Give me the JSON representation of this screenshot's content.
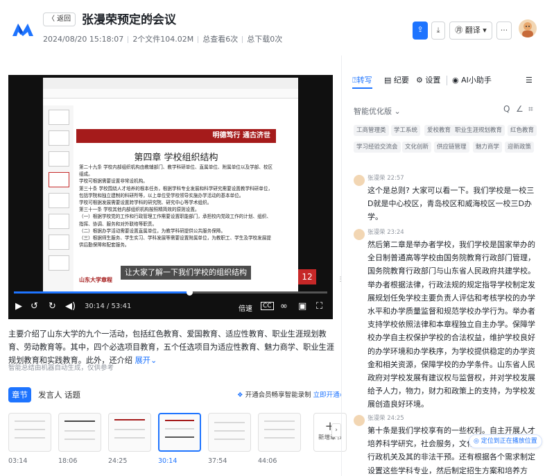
{
  "header": {
    "back_label": "〈 返回",
    "title": "张漫荣预定的会议",
    "edit_icon": "pencil-icon",
    "date": "2024/08/20 15:18:07",
    "files": "2个文件104.02M",
    "views": "总查看6次",
    "downloads": "总下载0次",
    "translate_label": "翻译",
    "more_label": "···",
    "share_icon": "share-icon",
    "download_icon": "download-icon"
  },
  "video": {
    "slide_banner": "明德笃行 通古济世",
    "slide_heading": "第四章 学校组织结构",
    "slide_body": [
      "第二十九条 学校内部组织机构由教辅部门、教学科研单位、直属单位、附属单位以及学部、校区组成。",
      "学校可根据需要设置非常设机构。",
      "第三十条 学校围绕人才培养的根本任务，根据学科专业发展和科学研究需要设置教学科研单位，包括学院和独立建制的科研所等，以上单位受学校领导实施办学活动的基本单位。",
      "学校可根据发展需要设置跨学科的研究院、研究中心等学术组织。",
      "第三十一条 学校其他内部组织机构按照精简效的原则设置。",
      "（一）根据学校党的工作和行政管理工作需要设置职能部门，承担校内党政工作的计划、组织、指挥、协调、服务和对外联络等职责。",
      "（二）根据办学活动需要设置直属单位，为教学科研提供公共服务保障。",
      "（三）根据师生服务、学生实习、学科发展等需要设置附属单位，为教职工、学生及学校发展提供后勤保障和配套服务。"
    ],
    "subtitle": "让大家了解一下我们学校的组织结构",
    "footer_text": "山东大学章程",
    "page_number": "12",
    "progress": 0.56,
    "time": "30:14 / 53:41",
    "speed_label": "倍速",
    "cc_label": "CC"
  },
  "summary": {
    "text": "主要介绍了山东大学的九个一活动，包括红色教育、爱国教育、适应性教育、职业生涯规划教育、劳动教育等。其中，四个必选项目教育，五个任选项目为适应性教育、魅力商学、职业生涯规划教育和实践教育。此外，还介绍",
    "expand_label": "展开",
    "note": "智能总结由机器自动生成，仅供参考"
  },
  "section_tabs": [
    "章节",
    "发言人",
    "话题"
  ],
  "vip": {
    "text": "开通会员畅享智能录制",
    "link": "立即开通"
  },
  "frames": {
    "times": [
      "03:14",
      "18:06",
      "24:25",
      "30:14",
      "37:54",
      "44:06"
    ],
    "add_label": "新增章节"
  },
  "right_panel": {
    "tabs": [
      "转写",
      "纪要",
      "设置",
      "AI小助手"
    ],
    "sort_label": "智能优化版",
    "tags": [
      "工商管理类",
      "学工系统",
      "爱校教育",
      "职业生涯规划教育",
      "红色教育",
      "学习经验交流会",
      "文化创新",
      "供应链管理",
      "魅力商学",
      "迎新政策"
    ],
    "messages": [
      {
        "speaker": "张漫荣",
        "time": "22:57",
        "text": "这个是总则? 大家可以看一下。我们学校是一校三D就是中心校区，青岛校区和威海校区一校三D办学。"
      },
      {
        "speaker": "张漫荣",
        "time": "23:24",
        "text": "然后第二章是举办者学校，我们学校是国家举办的全日制普通高等学校由国务院教育行政部门管理，国务院教育行政部门与山东省人民政府共建学校。举办者根据法律，行政法规的规定指导学校制定发展规划任免学校主要负责人评估和考核学校的办学水平和办学质量监督和规范学校办学行为。举办者支持学校依照法律和本章程独立自主办学。保障学校办学自主权保护学校的合法权益，维护学校良好的办学环境和办学秩序，为学校提供稳定的办学资金和相关资源，保障学校的办学条件。山东省人民政府对学校发展有建议权与监督权，并对学校发展给予人力，物力，财力和政策上的支持，为学校发展创造良好环境。"
      },
      {
        "speaker": "张漫荣",
        "time": "24:25",
        "text": "第十条是我们学校享有的一些权利。自主开展人才培养科学研究，社会服务，文化创新的活动，排除行政机关及其的非法干预。还有根据各个需求制定设置这些学科专业，然后制定招生方案和培养方案，制定教学计划，选编教材，组"
      }
    ],
    "locate_label": "定位到正在播放位置"
  }
}
